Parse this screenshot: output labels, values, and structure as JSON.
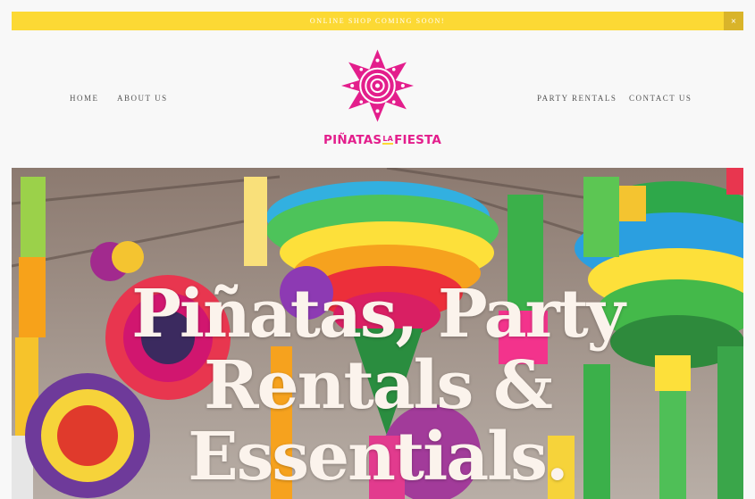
{
  "announcement": {
    "text": "ONLINE SHOP COMING SOON!",
    "close": "×"
  },
  "nav": {
    "home": "HOME",
    "about": "ABOUT US",
    "party_rentals": "PARTY RENTALS",
    "contact": "CONTACT US"
  },
  "logo": {
    "text_left": "PIÑATAS",
    "text_la": "LA",
    "text_right": "FIESTA",
    "icon": "star-pinata-icon"
  },
  "hero": {
    "line1": "Piñatas, Party",
    "line2": "Rentals &",
    "line3": "Essentials."
  },
  "colors": {
    "accent_yellow": "#fcd934",
    "brand_pink": "#e31e8c"
  }
}
